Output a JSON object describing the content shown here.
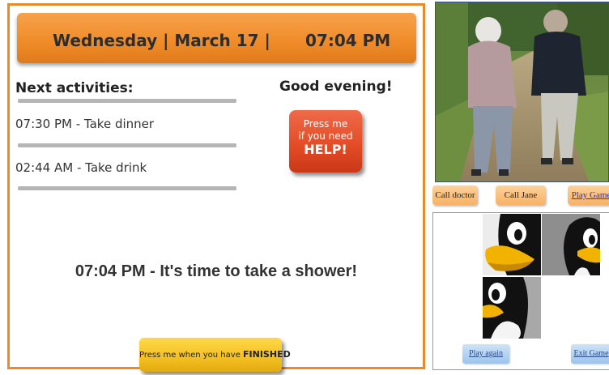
{
  "header": {
    "date": "Wednesday | March 17 |",
    "time": "07:04 PM"
  },
  "activities": {
    "title": "Next activities:",
    "items": [
      {
        "label": "07:30 PM - Take dinner"
      },
      {
        "label": "02:44 AM - Take drink"
      }
    ]
  },
  "greeting": "Good evening!",
  "help_button": {
    "line1": "Press me",
    "line2": "if you need",
    "line3": "HELP!"
  },
  "current_task": "07:04 PM - It's time to take a shower!",
  "finished_button": {
    "prefix": "Press me when you have ",
    "emphasis": "FINISHED"
  },
  "quick_actions": {
    "call_doctor": "Call doctor",
    "call_jane": "Call Jane",
    "play_game": "Play Game"
  },
  "game": {
    "play_again": "Play again",
    "exit_game": "Exit Game"
  },
  "colors": {
    "accent_orange": "#ea8a2a",
    "help_red": "#e24a24",
    "finish_yellow": "#f4c020"
  },
  "icons": {
    "photo": "elderly-walking-photo",
    "puzzle_tiles": "penguin-puzzle-tile"
  }
}
